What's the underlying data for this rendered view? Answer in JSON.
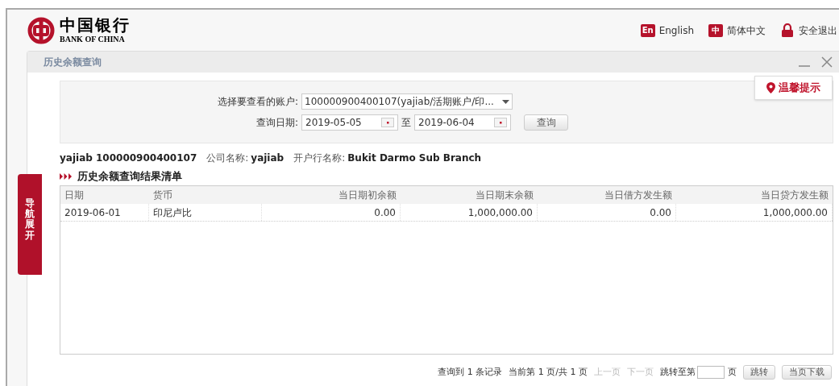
{
  "header": {
    "logo_cn": "中国银行",
    "logo_en": "BANK OF CHINA",
    "links": [
      {
        "kind": "lang-en",
        "badge": "En",
        "label": "English"
      },
      {
        "kind": "lang-cn",
        "badge": "中",
        "label": "简体中文"
      },
      {
        "kind": "logout",
        "label": "安全退出"
      }
    ]
  },
  "panel": {
    "title": "历史余额查询",
    "tip": "温馨提示",
    "nav_tab": "导航展开"
  },
  "filter": {
    "account_label": "选择要查看的账户:",
    "account_value": "100000900400107(yajiab/活期账户/印...",
    "date_label": "查询日期:",
    "date_from": "2019-05-05",
    "date_sep": "至",
    "date_to": "2019-06-04",
    "query_button": "查询"
  },
  "info": [
    {
      "value": "yajiab 100000900400107"
    },
    {
      "label": "公司名称:",
      "value": "yajiab"
    },
    {
      "label": "开户行名称:",
      "value": "Bukit Darmo Sub Branch"
    }
  ],
  "section_title": "历史余额查询结果清单",
  "table": {
    "columns": [
      "日期",
      "货币",
      "当日期初余额",
      "当日期末余额",
      "当日借方发生额",
      "当日贷方发生额"
    ],
    "rows": [
      [
        "2019-06-01",
        "印尼卢比",
        "0.00",
        "1,000,000.00",
        "0.00",
        "1,000,000.00"
      ]
    ]
  },
  "pagination": {
    "summary": "查询到 1 条记录",
    "page_info": "当前第 1 页/共 1 页",
    "prev": {
      "label": "上一页",
      "disabled": true
    },
    "next": {
      "label": "下一页",
      "disabled": true
    },
    "jump_label": "跳转至第",
    "jump_suffix": "页",
    "jump_button": "跳转",
    "download_button": "当页下载"
  }
}
